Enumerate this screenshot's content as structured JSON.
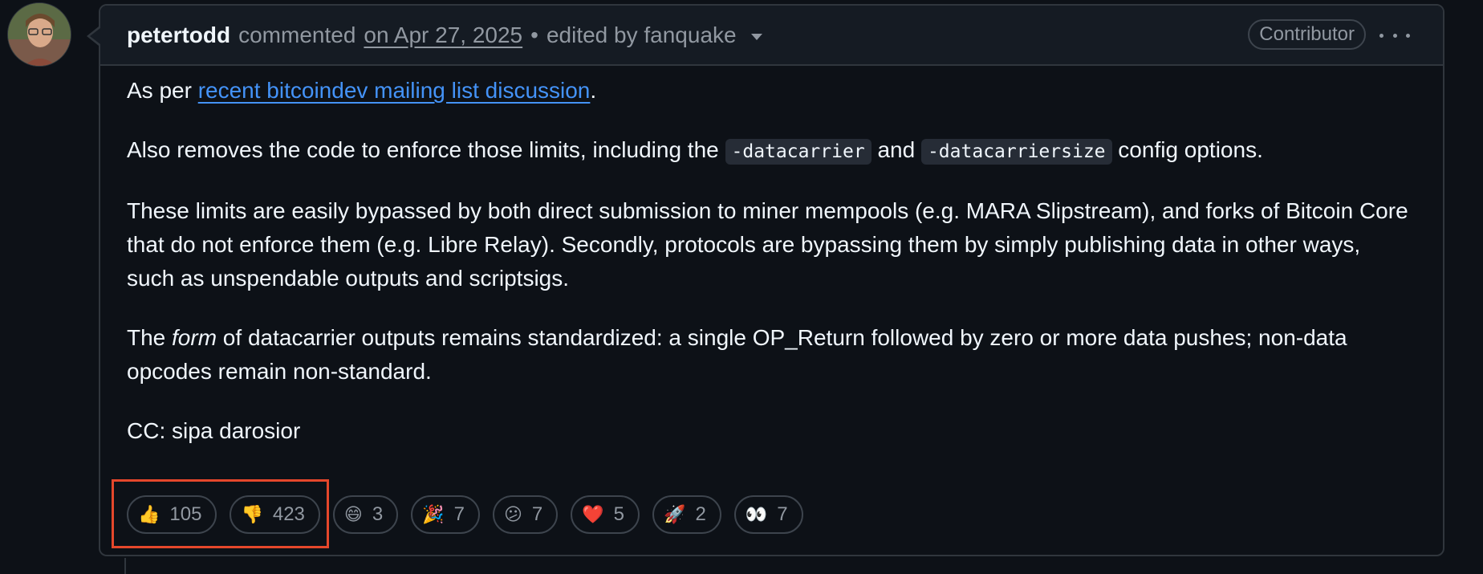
{
  "comment": {
    "author": "petertodd",
    "action": "commented",
    "date": "on Apr 27, 2025",
    "separator": "•",
    "edited": "edited by fanquake",
    "role_badge": "Contributor"
  },
  "body": {
    "p1": {
      "prefix": "As per ",
      "link": "recent bitcoindev mailing list discussion",
      "suffix": "."
    },
    "p2": {
      "text1": "Also removes the code to enforce those limits, including the ",
      "code1": "-datacarrier",
      "text2": " and ",
      "code2": "-datacarriersize",
      "text3": " config options."
    },
    "p3": "These limits are easily bypassed by both direct submission to miner mempools (e.g. MARA Slipstream), and forks of Bitcoin Core that do not enforce them (e.g. Libre Relay). Secondly, protocols are bypassing them by simply publishing data in other ways, such as unspendable outputs and scriptsigs.",
    "p4": {
      "prefix": "The ",
      "em": "form",
      "suffix": " of datacarrier outputs remains standardized: a single OP_Return followed by zero or more data pushes; non-data opcodes remain non-standard."
    },
    "p5": "CC: sipa darosior"
  },
  "reactions": [
    {
      "emoji": "👍",
      "icon": "thumbs-up-icon",
      "count": "105"
    },
    {
      "emoji": "👎",
      "icon": "thumbs-down-icon",
      "count": "423"
    },
    {
      "emoji": "😄",
      "icon": "laugh-icon",
      "count": "3"
    },
    {
      "emoji": "🎉",
      "icon": "hooray-icon",
      "count": "7"
    },
    {
      "emoji": "😕",
      "icon": "confused-icon",
      "count": "7"
    },
    {
      "emoji": "❤️",
      "icon": "heart-icon",
      "count": "5"
    },
    {
      "emoji": "🚀",
      "icon": "rocket-icon",
      "count": "2"
    },
    {
      "emoji": "👀",
      "icon": "eyes-icon",
      "count": "7"
    }
  ],
  "colors": {
    "background": "#0d1117",
    "header": "#151b23",
    "link": "#4493f8",
    "highlight": "#e5472b"
  }
}
